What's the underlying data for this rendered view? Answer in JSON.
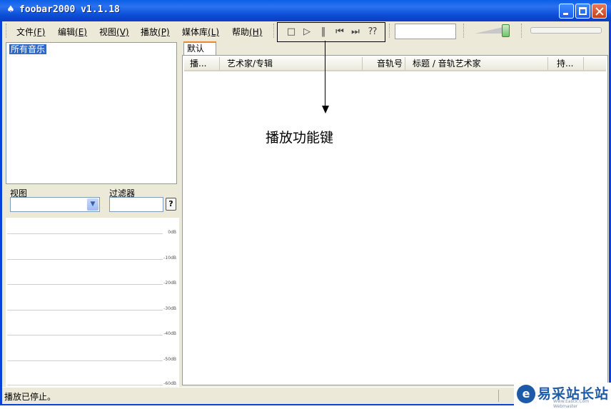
{
  "window": {
    "title": "foobar2000 v1.1.18"
  },
  "menu": [
    {
      "label": "文件",
      "key": "(F)"
    },
    {
      "label": "编辑",
      "key": "(E)"
    },
    {
      "label": "视图",
      "key": "(V)"
    },
    {
      "label": "播放",
      "key": "(P)"
    },
    {
      "label": "媒体库",
      "key": "(L)"
    },
    {
      "label": "帮助",
      "key": "(H)"
    }
  ],
  "controls": {
    "stop_icon": "stop-icon",
    "play_icon": "play-icon",
    "pause_icon": "pause-icon",
    "prev_icon": "previous-icon",
    "next_icon": "next-icon",
    "random_icon": "random-icon",
    "volume_level": 0.9
  },
  "library": {
    "root_item": "所有音乐",
    "view_label": "视图",
    "filter_label": "过滤器",
    "help_button": "?"
  },
  "vu_meter": {
    "ticks": [
      "0dB",
      "-10dB",
      "-20dB",
      "-30dB",
      "-40dB",
      "-50dB",
      "-60dB"
    ]
  },
  "playlist": {
    "tab": "默认",
    "columns": [
      "播...",
      "艺术家/专辑",
      "音轨号",
      "标题 / 音轨艺术家",
      "持..."
    ]
  },
  "annotation": {
    "text": "播放功能键"
  },
  "status": {
    "text": "播放已停止。"
  },
  "watermark": {
    "text": "易采站长站",
    "sub": "Www.Easck.Com Webmaster",
    "logo": "e"
  }
}
